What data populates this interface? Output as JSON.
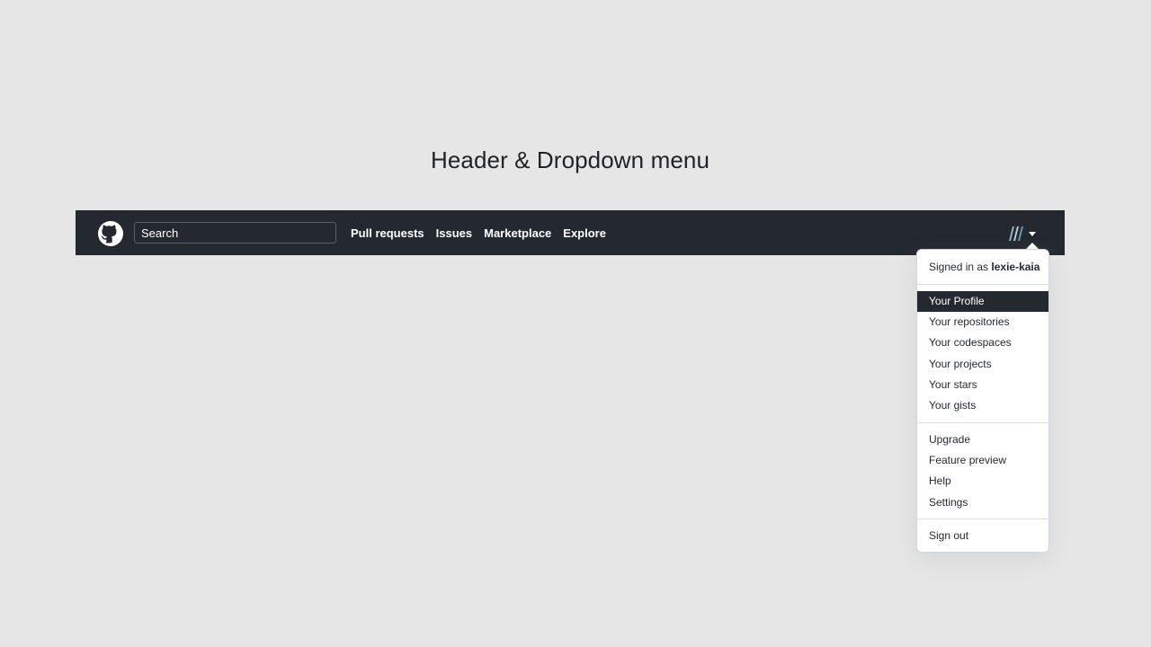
{
  "page": {
    "heading": "Header & Dropdown menu"
  },
  "header": {
    "search": {
      "placeholder": "Search",
      "value": ""
    },
    "nav": [
      {
        "label": "Pull requests"
      },
      {
        "label": "Issues"
      },
      {
        "label": "Marketplace"
      },
      {
        "label": "Explore"
      }
    ],
    "logo_icon": "github-mark-icon",
    "avatar_icon": "identicon-avatar",
    "caret_icon": "caret-down-icon"
  },
  "dropdown": {
    "signed_in_prefix": "Signed in as",
    "username": "lexie-kaia",
    "items": [
      {
        "label": "Your Profile",
        "active": true
      },
      {
        "label": "Your repositories"
      },
      {
        "label": "Your codespaces"
      },
      {
        "label": "Your projects"
      },
      {
        "label": "Your stars"
      },
      {
        "label": "Your gists"
      },
      {
        "label": "Upgrade"
      },
      {
        "label": "Feature preview"
      },
      {
        "label": "Help"
      },
      {
        "label": "Settings"
      },
      {
        "label": "Sign out"
      }
    ]
  },
  "colors": {
    "header_bg": "#24292f",
    "page_bg": "#e6e6e6",
    "active_item_bg": "#24292f",
    "avatar_accent": "#8fb3c9"
  }
}
